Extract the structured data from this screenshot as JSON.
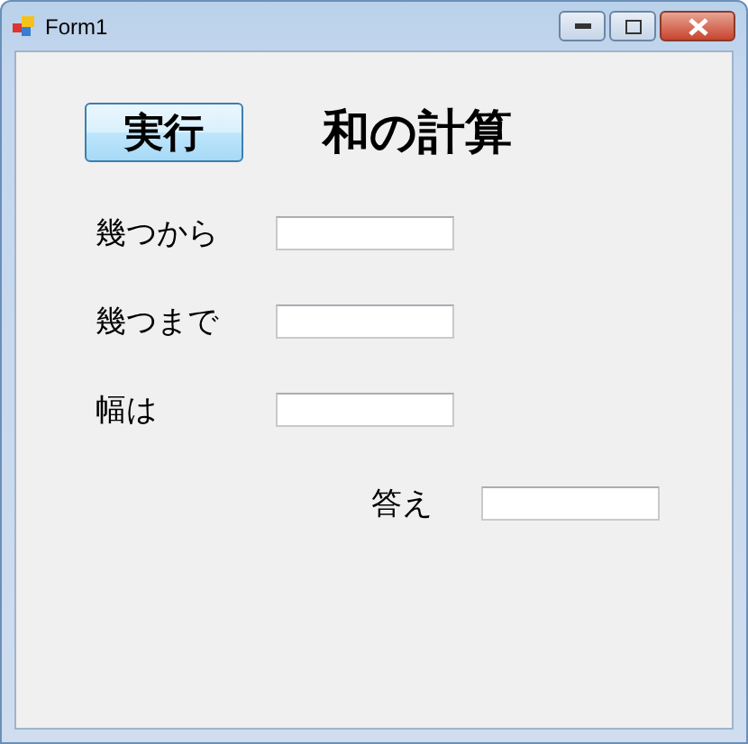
{
  "window": {
    "title": "Form1"
  },
  "run_button": {
    "label": "実行"
  },
  "heading": "和の計算",
  "fields": [
    {
      "label": "幾つから"
    },
    {
      "label": "幾つまで"
    },
    {
      "label": "幅は"
    }
  ],
  "answer": {
    "label": "答え"
  }
}
